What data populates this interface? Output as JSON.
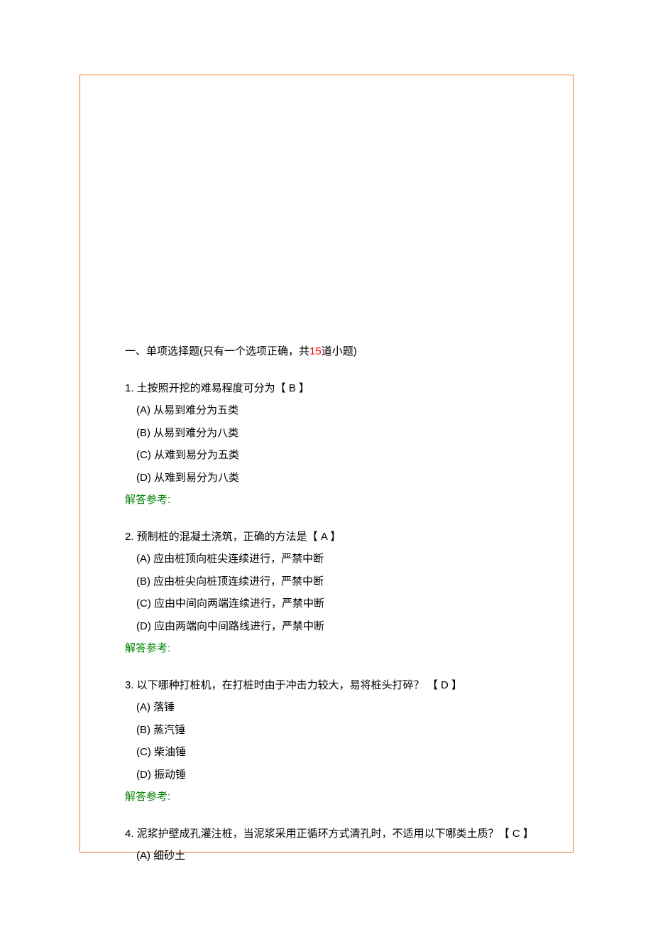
{
  "section": {
    "title_prefix": "一、单项选择题(只有一个选项正确，共",
    "count": "15",
    "title_suffix": "道小题)"
  },
  "questions": [
    {
      "number": "1.",
      "stem_prefix": "  土按照开挖的难易程度可分为【",
      "answer": "    B",
      "stem_suffix": "      】",
      "options": [
        "(A)  从易到难分为五类",
        "(B)  从易到难分为八类",
        "(C)  从难到易分为五类",
        "(D)  从难到易分为八类"
      ],
      "ref": "解答参考:"
    },
    {
      "number": "2.",
      "stem_prefix": " 预制桩的混凝土浇筑，正确的方法是【",
      "answer": "     A",
      "stem_suffix": "     】",
      "options": [
        "(A)  应由桩顶向桩尖连续进行，严禁中断",
        "(B)  应由桩尖向桩顶连续进行，严禁中断",
        "(C)  应由中间向两端连续进行，严禁中断",
        "(D)  应由两端向中间路线进行，严禁中断"
      ],
      "ref": "解答参考:"
    },
    {
      "number": "3.",
      "stem_prefix": " 以下哪种打桩机，在打桩时由于冲击力较大，易将桩头打碎？ 【",
      "answer": "    D",
      "stem_suffix": "       】",
      "options": [
        "(A)  落锤",
        "(B)  蒸汽锤",
        "(C)  柴油锤",
        "(D)  振动锤"
      ],
      "ref": "解答参考:"
    },
    {
      "number": "4.",
      "stem_prefix": " 泥浆护壁成孔灌注桩，当泥浆采用正循环方式清孔时，不适用以下哪类土质？【",
      "answer": "  C",
      "stem_suffix": "       】",
      "options": [
        "(A)  细砂土"
      ],
      "ref": ""
    }
  ]
}
